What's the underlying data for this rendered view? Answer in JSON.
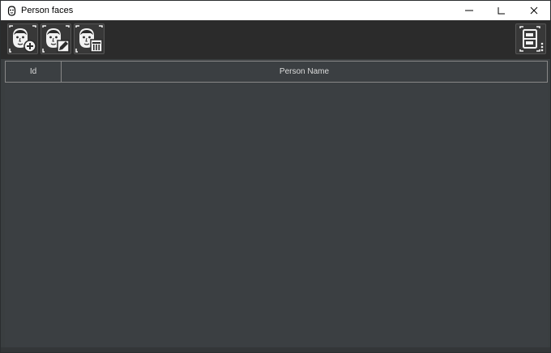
{
  "window": {
    "title": "Person faces",
    "minimize_glyph": "—",
    "maximize_glyph": "☐",
    "close_glyph": "✕"
  },
  "toolbar": {
    "buttons": [
      {
        "icon": "add-person-face-icon"
      },
      {
        "icon": "edit-person-face-icon"
      },
      {
        "icon": "delete-person-face-icon"
      }
    ],
    "right_button": {
      "icon": "column-layout-icon"
    }
  },
  "table": {
    "columns": [
      "Id",
      "Person Name"
    ],
    "rows": []
  },
  "colors": {
    "background": "#3a3e40",
    "toolbar": "#2b2b2b",
    "header_text": "#dcdcdc",
    "icon_face": "#f2f2f2"
  }
}
